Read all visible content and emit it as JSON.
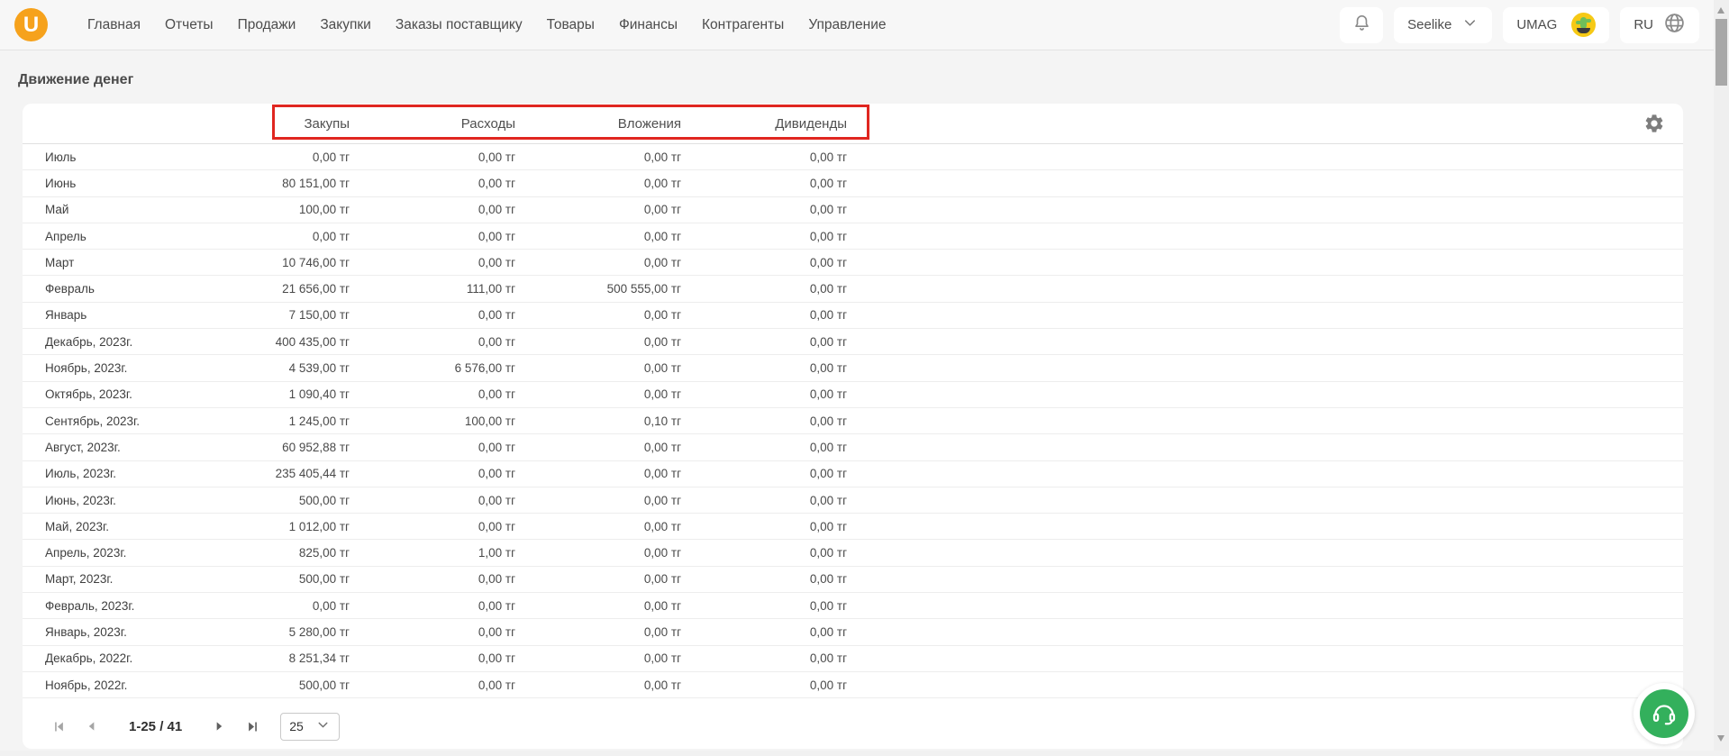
{
  "header": {
    "logo_letter": "U",
    "nav": [
      "Главная",
      "Отчеты",
      "Продажи",
      "Закупки",
      "Заказы поставщику",
      "Товары",
      "Финансы",
      "Контрагенты",
      "Управление"
    ],
    "store_selector": {
      "label": "Seelike"
    },
    "account": {
      "label": "UMAG"
    },
    "language": {
      "label": "RU"
    }
  },
  "page": {
    "title": "Движение денег"
  },
  "table": {
    "columns": [
      "Закупы",
      "Расходы",
      "Вложения",
      "Дивиденды"
    ],
    "rows": [
      {
        "month": "Июль",
        "values": [
          "0,00 тг",
          "0,00 тг",
          "0,00 тг",
          "0,00 тг"
        ]
      },
      {
        "month": "Июнь",
        "values": [
          "80 151,00 тг",
          "0,00 тг",
          "0,00 тг",
          "0,00 тг"
        ]
      },
      {
        "month": "Май",
        "values": [
          "100,00 тг",
          "0,00 тг",
          "0,00 тг",
          "0,00 тг"
        ]
      },
      {
        "month": "Апрель",
        "values": [
          "0,00 тг",
          "0,00 тг",
          "0,00 тг",
          "0,00 тг"
        ]
      },
      {
        "month": "Март",
        "values": [
          "10 746,00 тг",
          "0,00 тг",
          "0,00 тг",
          "0,00 тг"
        ]
      },
      {
        "month": "Февраль",
        "values": [
          "21 656,00 тг",
          "111,00 тг",
          "500 555,00 тг",
          "0,00 тг"
        ]
      },
      {
        "month": "Январь",
        "values": [
          "7 150,00 тг",
          "0,00 тг",
          "0,00 тг",
          "0,00 тг"
        ]
      },
      {
        "month": "Декабрь, 2023г.",
        "values": [
          "400 435,00 тг",
          "0,00 тг",
          "0,00 тг",
          "0,00 тг"
        ]
      },
      {
        "month": "Ноябрь, 2023г.",
        "values": [
          "4 539,00 тг",
          "6 576,00 тг",
          "0,00 тг",
          "0,00 тг"
        ]
      },
      {
        "month": "Октябрь, 2023г.",
        "values": [
          "1 090,40 тг",
          "0,00 тг",
          "0,00 тг",
          "0,00 тг"
        ]
      },
      {
        "month": "Сентябрь, 2023г.",
        "values": [
          "1 245,00 тг",
          "100,00 тг",
          "0,10 тг",
          "0,00 тг"
        ]
      },
      {
        "month": "Август, 2023г.",
        "values": [
          "60 952,88 тг",
          "0,00 тг",
          "0,00 тг",
          "0,00 тг"
        ]
      },
      {
        "month": "Июль, 2023г.",
        "values": [
          "235 405,44 тг",
          "0,00 тг",
          "0,00 тг",
          "0,00 тг"
        ]
      },
      {
        "month": "Июнь, 2023г.",
        "values": [
          "500,00 тг",
          "0,00 тг",
          "0,00 тг",
          "0,00 тг"
        ]
      },
      {
        "month": "Май, 2023г.",
        "values": [
          "1 012,00 тг",
          "0,00 тг",
          "0,00 тг",
          "0,00 тг"
        ]
      },
      {
        "month": "Апрель, 2023г.",
        "values": [
          "825,00 тг",
          "1,00 тг",
          "0,00 тг",
          "0,00 тг"
        ]
      },
      {
        "month": "Март, 2023г.",
        "values": [
          "500,00 тг",
          "0,00 тг",
          "0,00 тг",
          "0,00 тг"
        ]
      },
      {
        "month": "Февраль, 2023г.",
        "values": [
          "0,00 тг",
          "0,00 тг",
          "0,00 тг",
          "0,00 тг"
        ]
      },
      {
        "month": "Январь, 2023г.",
        "values": [
          "5 280,00 тг",
          "0,00 тг",
          "0,00 тг",
          "0,00 тг"
        ]
      },
      {
        "month": "Декабрь, 2022г.",
        "values": [
          "8 251,34 тг",
          "0,00 тг",
          "0,00 тг",
          "0,00 тг"
        ]
      },
      {
        "month": "Ноябрь, 2022г.",
        "values": [
          "500,00 тг",
          "0,00 тг",
          "0,00 тг",
          "0,00 тг"
        ]
      }
    ]
  },
  "pagination": {
    "range_label": "1-25 / 41",
    "page_size": "25"
  },
  "colors": {
    "accent_orange": "#F6A21C",
    "highlight_red": "#E02620",
    "support_green": "#33B05C"
  }
}
